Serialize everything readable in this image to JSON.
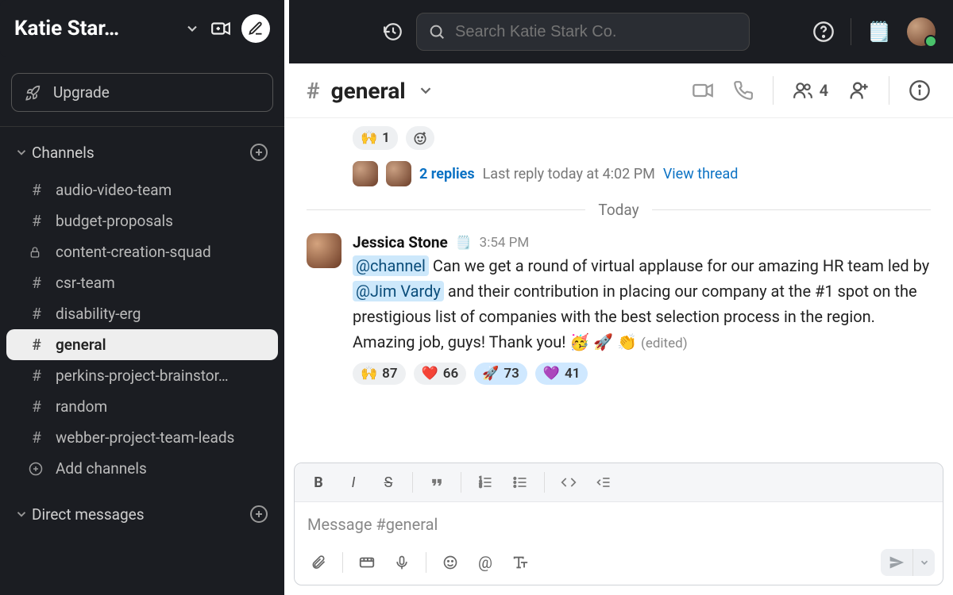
{
  "workspace": {
    "name": "Katie Star…"
  },
  "sidebar": {
    "upgrade": "Upgrade",
    "channels_label": "Channels",
    "add_channels": "Add channels",
    "channels": [
      {
        "name": "audio-video-team",
        "icon": "hash"
      },
      {
        "name": "budget-proposals",
        "icon": "hash"
      },
      {
        "name": "content-creation-squad",
        "icon": "lock"
      },
      {
        "name": "csr-team",
        "icon": "hash"
      },
      {
        "name": "disability-erg",
        "icon": "hash"
      },
      {
        "name": "general",
        "icon": "hash",
        "active": true
      },
      {
        "name": "perkins-project-brainstor…",
        "icon": "hash"
      },
      {
        "name": "random",
        "icon": "hash"
      },
      {
        "name": "webber-project-team-leads",
        "icon": "hash"
      }
    ],
    "dms_label": "Direct messages"
  },
  "search": {
    "placeholder": "Search Katie Stark Co."
  },
  "channel_header": {
    "name": "general",
    "members": "4"
  },
  "prev_message": {
    "reaction_emoji": "🙌",
    "reaction_count": "1",
    "replies": "2 replies",
    "last_reply": "Last reply today at 4:02 PM",
    "view": "View thread"
  },
  "divider": "Today",
  "message": {
    "author": "Jessica Stone",
    "time": "3:54 PM",
    "mention1": "@channel",
    "text1": " Can we get a round of virtual applause for our amazing HR team led by ",
    "mention2": "@Jim Vardy",
    "text2": " and their contribution in placing our company at the #1 spot on the prestigious list of companies with the best selection process in the region. Amazing job, guys! Thank you! 🥳 🚀 👏 ",
    "edited": "(edited)",
    "reactions": [
      {
        "emoji": "🙌",
        "count": "87"
      },
      {
        "emoji": "❤️",
        "count": "66"
      },
      {
        "emoji": "🚀",
        "count": "73",
        "active": true
      },
      {
        "emoji": "💜",
        "count": "41",
        "active": true
      }
    ]
  },
  "composer": {
    "placeholder": "Message #general"
  }
}
